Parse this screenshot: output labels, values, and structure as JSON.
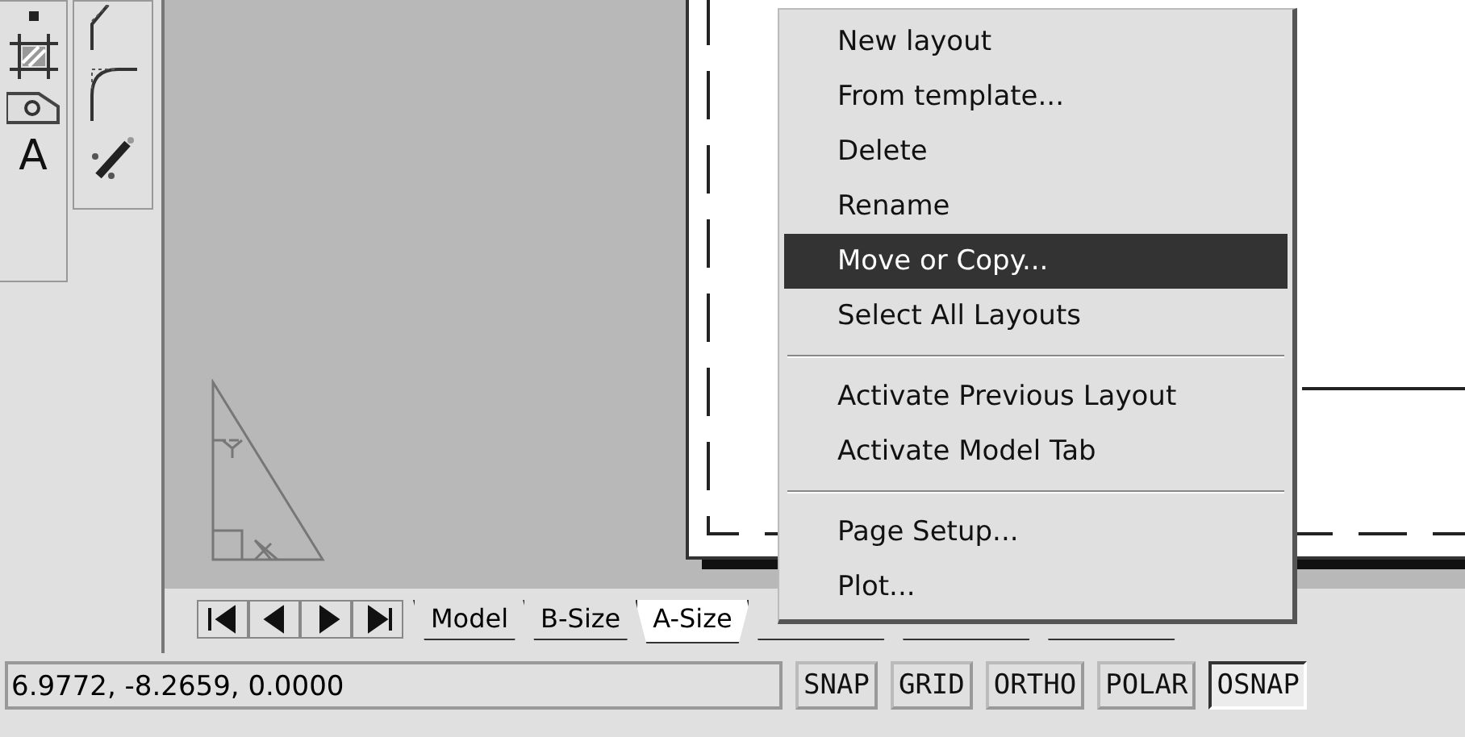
{
  "toolbar_left": {
    "text_tool_glyph": "A"
  },
  "layout_tabs": [
    {
      "label": "Model",
      "selected": false
    },
    {
      "label": "B-Size",
      "selected": false
    },
    {
      "label": "A-Size",
      "selected": true
    }
  ],
  "context_menu": {
    "items": [
      {
        "kind": "item",
        "label": "New layout",
        "selected": false
      },
      {
        "kind": "item",
        "label": "From template...",
        "selected": false
      },
      {
        "kind": "item",
        "label": "Delete",
        "selected": false
      },
      {
        "kind": "item",
        "label": "Rename",
        "selected": false
      },
      {
        "kind": "item",
        "label": "Move or Copy...",
        "selected": true
      },
      {
        "kind": "item",
        "label": "Select All Layouts",
        "selected": false
      },
      {
        "kind": "separator"
      },
      {
        "kind": "item",
        "label": "Activate Previous Layout",
        "selected": false
      },
      {
        "kind": "item",
        "label": "Activate Model Tab",
        "selected": false
      },
      {
        "kind": "separator"
      },
      {
        "kind": "item",
        "label": "Page Setup...",
        "selected": false
      },
      {
        "kind": "item",
        "label": "Plot...",
        "selected": false
      }
    ]
  },
  "status_bar": {
    "coordinates": "6.9772,  -8.2659, 0.0000",
    "toggles": [
      {
        "label": "SNAP",
        "on": false
      },
      {
        "label": "GRID",
        "on": false
      },
      {
        "label": "ORTHO",
        "on": false
      },
      {
        "label": "POLAR",
        "on": false
      },
      {
        "label": "OSNAP",
        "on": true
      }
    ]
  }
}
